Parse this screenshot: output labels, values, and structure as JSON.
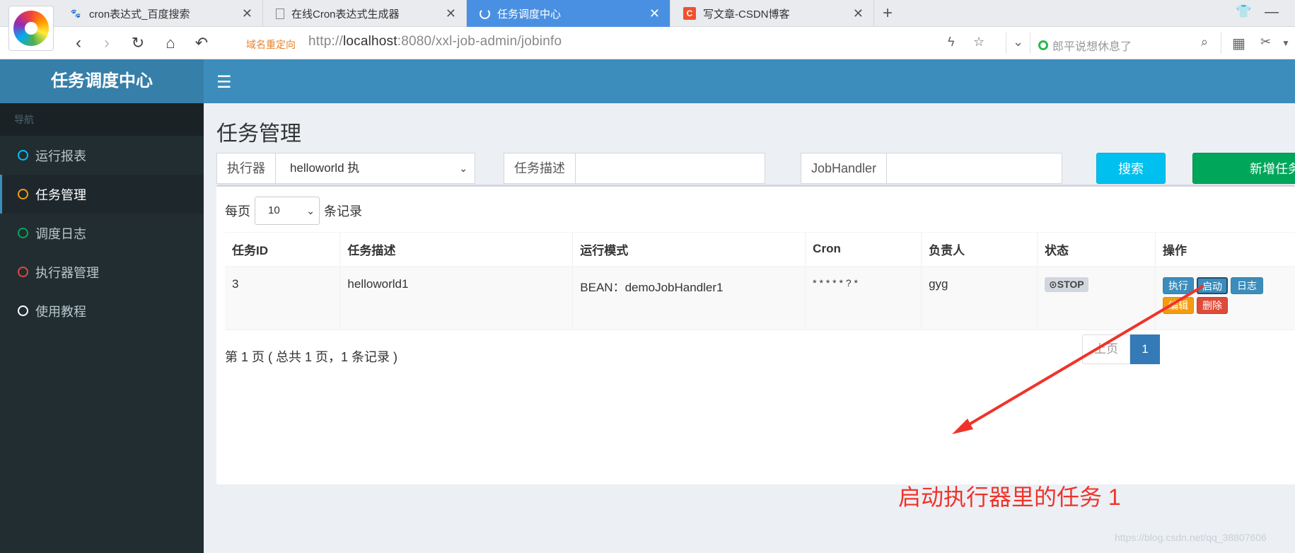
{
  "browser": {
    "tabs": [
      {
        "title": "cron表达式_百度搜索",
        "icon": "baidu-paw-icon"
      },
      {
        "title": "在线Cron表达式生成器",
        "icon": "page-icon"
      },
      {
        "title": "任务调度中心",
        "icon": "loading-icon",
        "active": true
      },
      {
        "title": "写文章-CSDN博客",
        "icon": "csdn-icon"
      }
    ],
    "redirect_tag": "域名重定向",
    "url_prefix": "http://",
    "url_host": "localhost",
    "url_rest": ":8080/xxl-job-admin/jobinfo",
    "search_placeholder": "郎平说想休息了"
  },
  "app": {
    "logo": "任务调度中心",
    "nav_header": "导航",
    "menu": [
      {
        "label": "运行报表",
        "color": "#00c0ef"
      },
      {
        "label": "任务管理",
        "color": "#f39c12",
        "active": true
      },
      {
        "label": "调度日志",
        "color": "#00a65a"
      },
      {
        "label": "执行器管理",
        "color": "#dd4b39"
      },
      {
        "label": "使用教程",
        "color": "#ffffff"
      }
    ]
  },
  "page": {
    "title": "任务管理",
    "filters": {
      "executor_label": "执行器",
      "executor_value": "helloworld 执",
      "desc_label": "任务描述",
      "desc_value": "",
      "handler_label": "JobHandler",
      "handler_value": ""
    },
    "search_button": "搜索",
    "add_button": "新增任务",
    "length": {
      "prefix": "每页",
      "value": "10",
      "suffix": "条记录"
    },
    "table": {
      "headers": [
        "任务ID",
        "任务描述",
        "运行模式",
        "Cron",
        "负责人",
        "状态",
        "操作"
      ],
      "rows": [
        {
          "id": "3",
          "desc": "helloworld1",
          "mode": "BEAN：demoJobHandler1",
          "cron": "* * * * * ? *",
          "owner": "gyg",
          "status": "⊙STOP",
          "ops": {
            "run": "执行",
            "start": "启动",
            "log": "日志",
            "edit": "编辑",
            "delete": "删除"
          }
        }
      ]
    },
    "info": "第 1 页 ( 总共 1 页，1 条记录 )",
    "pagination": {
      "prev": "上页",
      "current": "1"
    }
  },
  "annotation": "启动执行器里的任务 1",
  "watermark": "https://blog.csdn.net/qq_38807606"
}
